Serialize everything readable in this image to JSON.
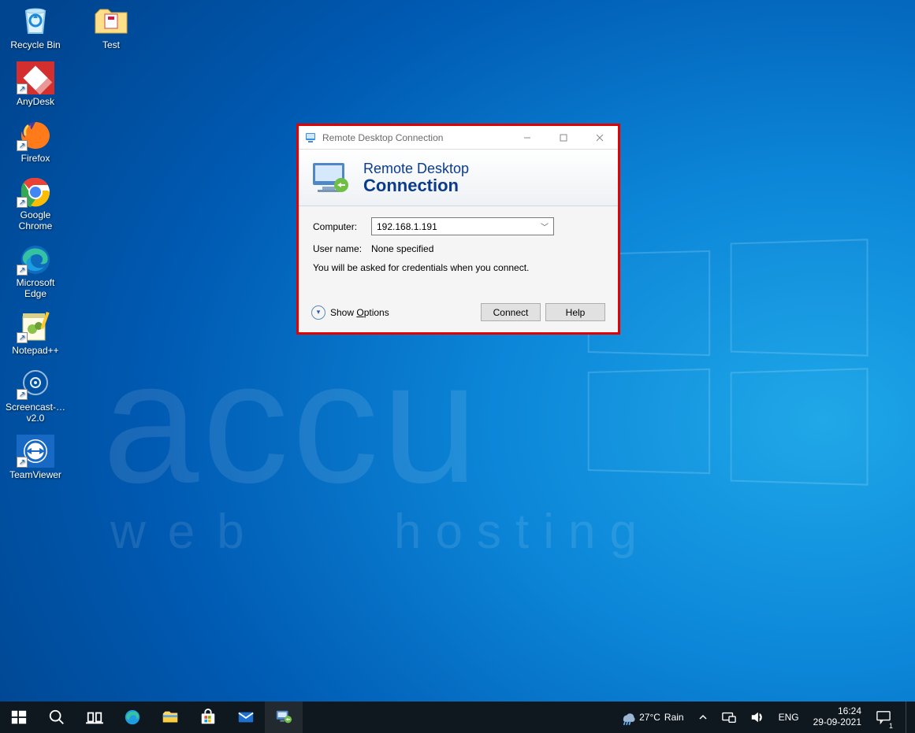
{
  "desktop_icons": {
    "recycle_bin": {
      "label": "Recycle Bin"
    },
    "test": {
      "label": "Test"
    },
    "anydesk": {
      "label": "AnyDesk"
    },
    "firefox": {
      "label": "Firefox"
    },
    "chrome": {
      "label": "Google Chrome"
    },
    "edge": {
      "label": "Microsoft Edge"
    },
    "notepadpp": {
      "label": "Notepad++"
    },
    "screencast": {
      "label": "Screencast-… v2.0"
    },
    "teamviewer": {
      "label": "TeamViewer"
    }
  },
  "watermark": {
    "top": "accu",
    "bottom_left": "web",
    "bottom_right": "hosting"
  },
  "rdc": {
    "window_title": "Remote Desktop Connection",
    "banner_line1": "Remote Desktop",
    "banner_line2": "Connection",
    "labels": {
      "computer": "Computer:",
      "username": "User name:"
    },
    "values": {
      "computer": "192.168.1.191",
      "username": "None specified"
    },
    "hint": "You will be asked for credentials when you connect.",
    "show_options_pre": "Show ",
    "show_options_u": "O",
    "show_options_post": "ptions",
    "buttons": {
      "connect": "Connect",
      "help": "Help"
    }
  },
  "taskbar": {
    "weather": {
      "temp": "27°C",
      "cond": "Rain"
    },
    "lang": "ENG",
    "clock": {
      "time": "16:24",
      "date": "29-09-2021"
    },
    "notifications": "1"
  }
}
